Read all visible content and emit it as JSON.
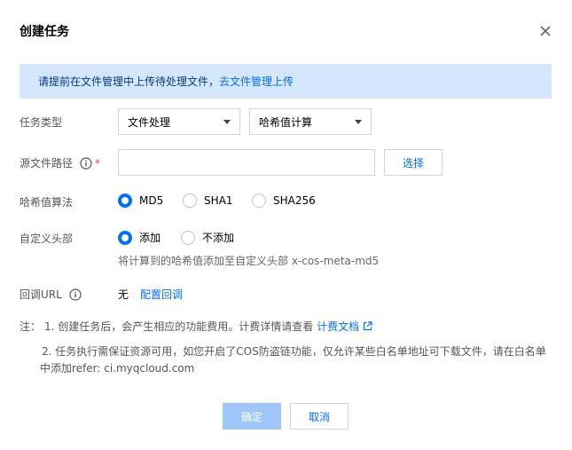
{
  "dialog": {
    "title": "创建任务",
    "close_icon": "close-icon"
  },
  "notice": {
    "text": "请提前在文件管理中上传待处理文件，",
    "link": "去文件管理上传",
    "bg_color": "#d5e7fe"
  },
  "task_type": {
    "label": "任务类型",
    "select1": "文件处理",
    "select2": "哈希值计算"
  },
  "source_path": {
    "label": "源文件路径",
    "required_mark": "*",
    "value": "",
    "button": "选择"
  },
  "hash_algorithm": {
    "label": "哈希值算法",
    "options": [
      {
        "label": "MD5",
        "selected": true
      },
      {
        "label": "SHA1",
        "selected": false
      },
      {
        "label": "SHA256",
        "selected": false
      }
    ]
  },
  "custom_header": {
    "label": "自定义头部",
    "options": [
      {
        "label": "添加",
        "selected": true
      },
      {
        "label": "不添加",
        "selected": false
      }
    ],
    "hint": "将计算到的哈希值添加至自定义头部 x-cos-meta-md5"
  },
  "callback": {
    "label": "回调URL",
    "value": "无",
    "link": "配置回调"
  },
  "notes": {
    "prefix": "注：",
    "item1": "1. 创建任务后，会产生相应的功能费用。计费详情请查看",
    "item1_link": "计费文档",
    "item2_line1": "2. 任务执行需保证资源可用，如您开启了COS防盗链功能，仅允许某些白名单地址可下载文件，请在白名单",
    "item2_line2": "中添加refer: ci.myqcloud.com"
  },
  "footer": {
    "ok": "确定",
    "cancel": "取消"
  },
  "colors": {
    "accent": "#006eff",
    "disabled_primary": "#9ec6fb"
  }
}
